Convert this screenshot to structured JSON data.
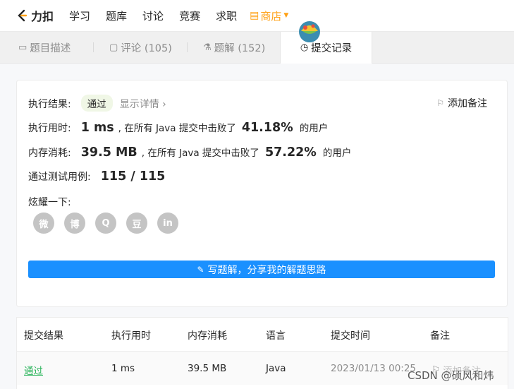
{
  "nav": {
    "brand": "力扣",
    "items": [
      "学习",
      "题库",
      "讨论",
      "竞赛",
      "求职"
    ],
    "store": "商店"
  },
  "tabs": [
    {
      "label": "题目描述",
      "icon": "document-icon"
    },
    {
      "label": "评论 (105)",
      "icon": "comment-icon"
    },
    {
      "label": "题解 (152)",
      "icon": "flask-icon"
    },
    {
      "label": "提交记录",
      "icon": "clock-icon"
    }
  ],
  "result": {
    "label": "执行结果:",
    "status": "通过",
    "detail_link": "显示详情",
    "add_note": "添加备注",
    "runtime": {
      "label": "执行用时:",
      "value": "1 ms",
      "mid": ", 在所有 Java 提交中击败了",
      "percent": "41.18%",
      "suffix": "的用户"
    },
    "memory": {
      "label": "内存消耗:",
      "value": "39.5 MB",
      "mid": ", 在所有 Java 提交中击败了",
      "percent": "57.22%",
      "suffix": "的用户"
    },
    "tests": {
      "label": "通过测试用例:",
      "value": "115 / 115"
    },
    "share_label": "炫耀一下:",
    "share_icons": [
      {
        "name": "wechat-icon",
        "glyph": "微"
      },
      {
        "name": "weibo-icon",
        "glyph": "博"
      },
      {
        "name": "qq-icon",
        "glyph": "Q"
      },
      {
        "name": "douban-icon",
        "glyph": "豆"
      },
      {
        "name": "linkedin-icon",
        "glyph": "in"
      }
    ],
    "write_button": "写题解，分享我的解题思路"
  },
  "table": {
    "headers": [
      "提交结果",
      "执行用时",
      "内存消耗",
      "语言",
      "提交时间",
      "备注"
    ],
    "rows": [
      {
        "status": "通过",
        "runtime": "1 ms",
        "memory": "39.5 MB",
        "language": "Java",
        "time": "2023/01/13 00:25",
        "note": "添加备注"
      }
    ]
  },
  "watermark": "CSDN @硕风和炜",
  "colors": {
    "accent": "#ffa116",
    "primary_button": "#1a90ff",
    "success": "#2db55d"
  }
}
